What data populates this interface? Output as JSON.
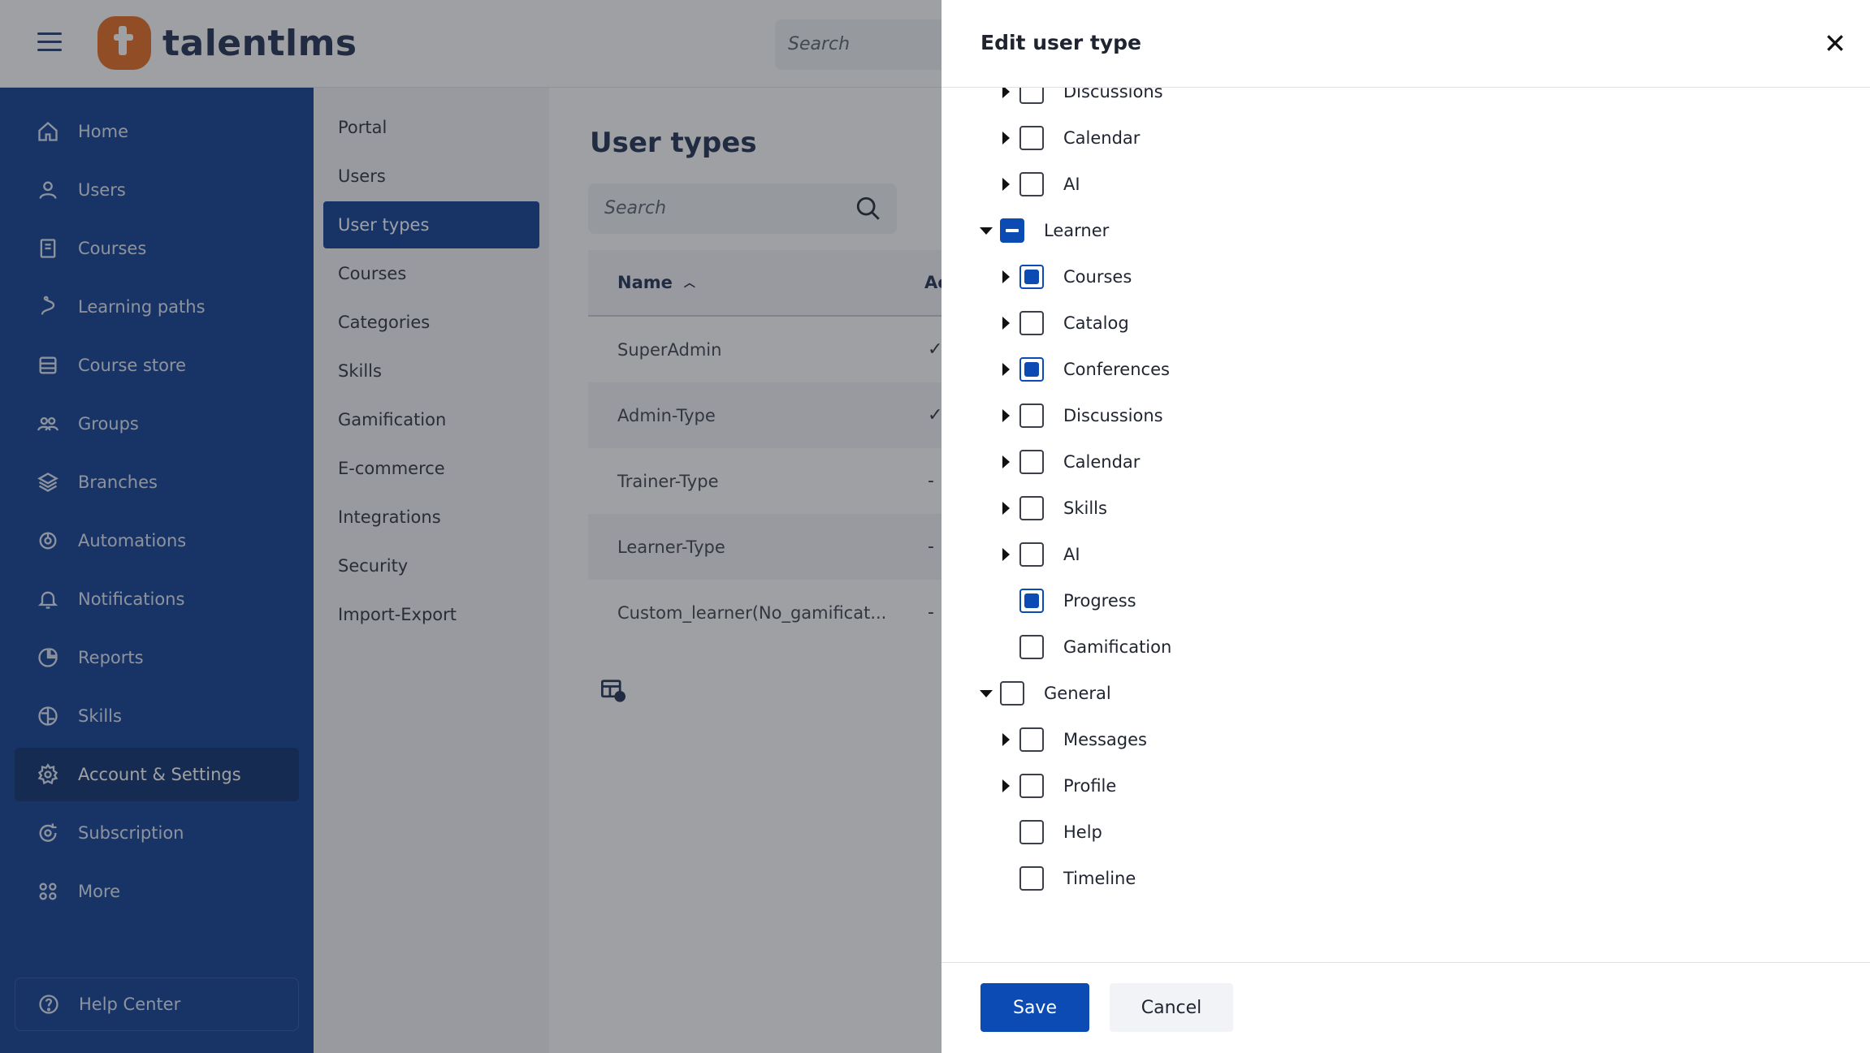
{
  "topbar": {
    "logo_text": "talentlms",
    "search_placeholder": "Search"
  },
  "sidebar": {
    "items": [
      {
        "label": "Home",
        "icon": "home-icon"
      },
      {
        "label": "Users",
        "icon": "user-icon"
      },
      {
        "label": "Courses",
        "icon": "book-icon"
      },
      {
        "label": "Learning paths",
        "icon": "path-icon"
      },
      {
        "label": "Course store",
        "icon": "store-icon"
      },
      {
        "label": "Groups",
        "icon": "groups-icon"
      },
      {
        "label": "Branches",
        "icon": "layers-icon"
      },
      {
        "label": "Automations",
        "icon": "automation-icon"
      },
      {
        "label": "Notifications",
        "icon": "bell-icon"
      },
      {
        "label": "Reports",
        "icon": "pie-chart-icon"
      },
      {
        "label": "Skills",
        "icon": "brain-icon"
      },
      {
        "label": "Account & Settings",
        "icon": "gear-icon",
        "active": true
      },
      {
        "label": "Subscription",
        "icon": "subscription-icon"
      },
      {
        "label": "More",
        "icon": "grid-icon"
      }
    ],
    "help_center": "Help Center"
  },
  "subnav": {
    "items": [
      "Portal",
      "Users",
      "User types",
      "Courses",
      "Categories",
      "Skills",
      "Gamification",
      "E-commerce",
      "Integrations",
      "Security",
      "Import-Export"
    ],
    "active_index": 2
  },
  "content": {
    "title": "User types",
    "search_placeholder": "Search",
    "table": {
      "col_name": "Name",
      "col_second": "Ac",
      "rows": [
        {
          "name": "SuperAdmin",
          "mark": "✓"
        },
        {
          "name": "Admin-Type",
          "mark": "✓"
        },
        {
          "name": "Trainer-Type",
          "mark": "-"
        },
        {
          "name": "Learner-Type",
          "mark": "-"
        },
        {
          "name": "Custom_learner(No_gamificat...",
          "mark": "-"
        }
      ]
    }
  },
  "drawer": {
    "title": "Edit user type",
    "tree": [
      {
        "label": "Discussions",
        "level": 1,
        "caret": "right",
        "state": "unchecked"
      },
      {
        "label": "Calendar",
        "level": 1,
        "caret": "right",
        "state": "unchecked"
      },
      {
        "label": "AI",
        "level": 1,
        "caret": "right",
        "state": "unchecked"
      },
      {
        "label": "Learner",
        "level": 0,
        "caret": "down",
        "state": "partial"
      },
      {
        "label": "Courses",
        "level": 1,
        "caret": "right",
        "state": "checked"
      },
      {
        "label": "Catalog",
        "level": 1,
        "caret": "right",
        "state": "unchecked"
      },
      {
        "label": "Conferences",
        "level": 1,
        "caret": "right",
        "state": "checked"
      },
      {
        "label": "Discussions",
        "level": 1,
        "caret": "right",
        "state": "unchecked"
      },
      {
        "label": "Calendar",
        "level": 1,
        "caret": "right",
        "state": "unchecked"
      },
      {
        "label": "Skills",
        "level": 1,
        "caret": "right",
        "state": "unchecked"
      },
      {
        "label": "AI",
        "level": 1,
        "caret": "right",
        "state": "unchecked"
      },
      {
        "label": "Progress",
        "level": 1,
        "caret": "none",
        "state": "checked"
      },
      {
        "label": "Gamification",
        "level": 1,
        "caret": "none",
        "state": "unchecked"
      },
      {
        "label": "General",
        "level": 0,
        "caret": "down",
        "state": "unchecked"
      },
      {
        "label": "Messages",
        "level": 1,
        "caret": "right",
        "state": "unchecked"
      },
      {
        "label": "Profile",
        "level": 1,
        "caret": "right",
        "state": "unchecked"
      },
      {
        "label": "Help",
        "level": 1,
        "caret": "none",
        "state": "unchecked"
      },
      {
        "label": "Timeline",
        "level": 1,
        "caret": "none",
        "state": "unchecked"
      }
    ],
    "save_label": "Save",
    "cancel_label": "Cancel"
  }
}
